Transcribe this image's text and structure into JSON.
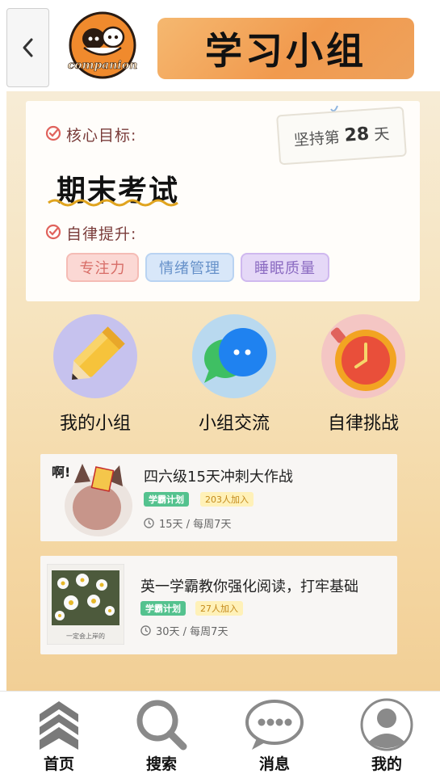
{
  "header": {
    "title": "学习小组",
    "logo_text": "companion"
  },
  "goal_card": {
    "core_label": "核心目标:",
    "core_goal": "期末考试",
    "streak_prefix": "坚持第",
    "streak_days": "28",
    "streak_suffix": "天",
    "self_label": "自律提升:",
    "tags": [
      "专注力",
      "情绪管理",
      "睡眠质量"
    ]
  },
  "features": [
    {
      "label": "我的小组",
      "icon": "pencil-icon"
    },
    {
      "label": "小组交流",
      "icon": "chat-icon"
    },
    {
      "label": "自律挑战",
      "icon": "stopwatch-icon"
    }
  ],
  "plans": [
    {
      "title": "四六级15天冲刺大作战",
      "badge": "学霸计划",
      "joined": "203人加入",
      "meta": "15天 / 每周7天"
    },
    {
      "title": "英一学霸教你强化阅读，打牢基础",
      "badge": "学霸计划",
      "joined": "27人加入",
      "meta": "30天 / 每周7天",
      "thumb_caption": "一定会上岸的"
    }
  ],
  "bottom_nav": [
    {
      "label": "首页",
      "icon": "home-chevrons-icon"
    },
    {
      "label": "搜索",
      "icon": "search-icon"
    },
    {
      "label": "消息",
      "icon": "message-icon"
    },
    {
      "label": "我的",
      "icon": "profile-icon"
    }
  ],
  "colors": {
    "accent_orange": "#f19a4e",
    "badge_green": "#54c28e",
    "badge_yellow": "#fff1b8",
    "goal_text": "#7a3c3a"
  }
}
